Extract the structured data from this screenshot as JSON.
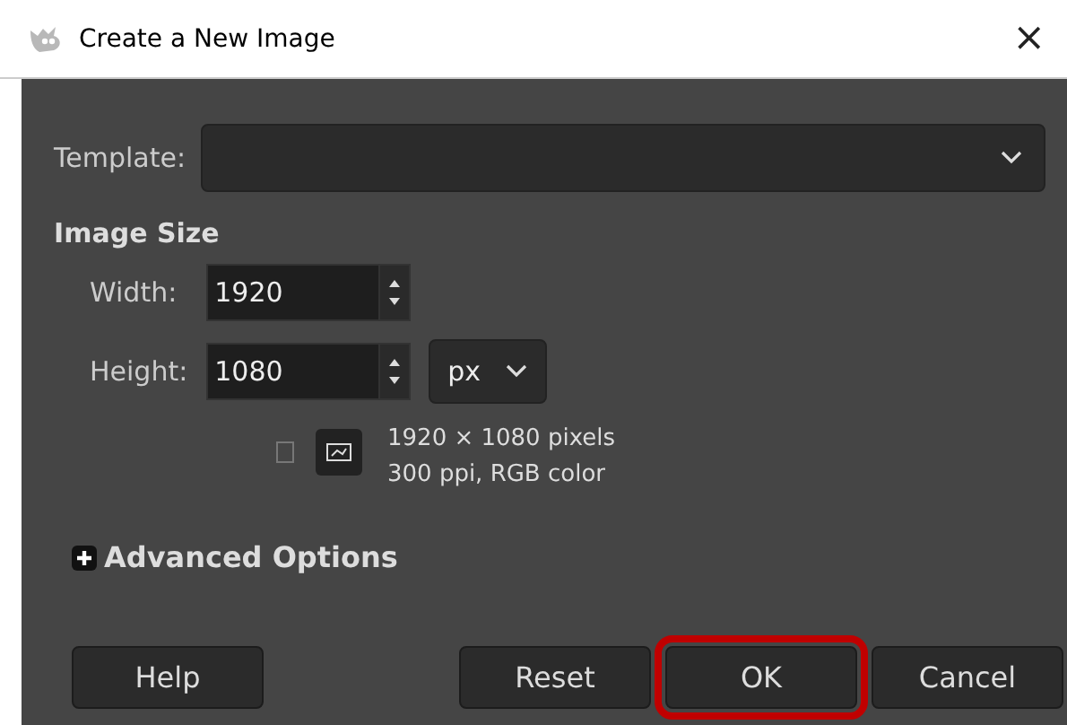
{
  "window": {
    "title": "Create a New Image",
    "close": "×"
  },
  "template": {
    "label": "Template:"
  },
  "image_size": {
    "heading": "Image Size",
    "width": {
      "label": "Width:",
      "value": "1920"
    },
    "height": {
      "label": "Height:",
      "value": "1080"
    },
    "unit": "px",
    "orientations": [
      {
        "kind": "portrait",
        "selected": false
      },
      {
        "kind": "landscape",
        "selected": true
      }
    ],
    "info": [
      "1920 × 1080 pixels",
      "300 ppi, RGB color"
    ]
  },
  "advanced": {
    "label": "Advanced Options",
    "expanded": false
  },
  "buttons": [
    {
      "label": "Help",
      "highlighted": false
    },
    {
      "label": "Reset",
      "highlighted": false
    },
    {
      "label": "OK",
      "highlighted": true
    },
    {
      "label": "Cancel",
      "highlighted": false
    }
  ]
}
